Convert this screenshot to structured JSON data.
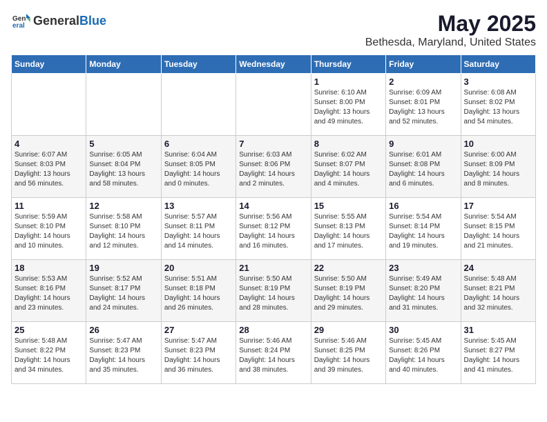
{
  "header": {
    "logo_general": "General",
    "logo_blue": "Blue",
    "title": "May 2025",
    "subtitle": "Bethesda, Maryland, United States"
  },
  "days_of_week": [
    "Sunday",
    "Monday",
    "Tuesday",
    "Wednesday",
    "Thursday",
    "Friday",
    "Saturday"
  ],
  "weeks": [
    [
      {
        "day": "",
        "info": ""
      },
      {
        "day": "",
        "info": ""
      },
      {
        "day": "",
        "info": ""
      },
      {
        "day": "",
        "info": ""
      },
      {
        "day": "1",
        "info": "Sunrise: 6:10 AM\nSunset: 8:00 PM\nDaylight: 13 hours\nand 49 minutes."
      },
      {
        "day": "2",
        "info": "Sunrise: 6:09 AM\nSunset: 8:01 PM\nDaylight: 13 hours\nand 52 minutes."
      },
      {
        "day": "3",
        "info": "Sunrise: 6:08 AM\nSunset: 8:02 PM\nDaylight: 13 hours\nand 54 minutes."
      }
    ],
    [
      {
        "day": "4",
        "info": "Sunrise: 6:07 AM\nSunset: 8:03 PM\nDaylight: 13 hours\nand 56 minutes."
      },
      {
        "day": "5",
        "info": "Sunrise: 6:05 AM\nSunset: 8:04 PM\nDaylight: 13 hours\nand 58 minutes."
      },
      {
        "day": "6",
        "info": "Sunrise: 6:04 AM\nSunset: 8:05 PM\nDaylight: 14 hours\nand 0 minutes."
      },
      {
        "day": "7",
        "info": "Sunrise: 6:03 AM\nSunset: 8:06 PM\nDaylight: 14 hours\nand 2 minutes."
      },
      {
        "day": "8",
        "info": "Sunrise: 6:02 AM\nSunset: 8:07 PM\nDaylight: 14 hours\nand 4 minutes."
      },
      {
        "day": "9",
        "info": "Sunrise: 6:01 AM\nSunset: 8:08 PM\nDaylight: 14 hours\nand 6 minutes."
      },
      {
        "day": "10",
        "info": "Sunrise: 6:00 AM\nSunset: 8:09 PM\nDaylight: 14 hours\nand 8 minutes."
      }
    ],
    [
      {
        "day": "11",
        "info": "Sunrise: 5:59 AM\nSunset: 8:10 PM\nDaylight: 14 hours\nand 10 minutes."
      },
      {
        "day": "12",
        "info": "Sunrise: 5:58 AM\nSunset: 8:10 PM\nDaylight: 14 hours\nand 12 minutes."
      },
      {
        "day": "13",
        "info": "Sunrise: 5:57 AM\nSunset: 8:11 PM\nDaylight: 14 hours\nand 14 minutes."
      },
      {
        "day": "14",
        "info": "Sunrise: 5:56 AM\nSunset: 8:12 PM\nDaylight: 14 hours\nand 16 minutes."
      },
      {
        "day": "15",
        "info": "Sunrise: 5:55 AM\nSunset: 8:13 PM\nDaylight: 14 hours\nand 17 minutes."
      },
      {
        "day": "16",
        "info": "Sunrise: 5:54 AM\nSunset: 8:14 PM\nDaylight: 14 hours\nand 19 minutes."
      },
      {
        "day": "17",
        "info": "Sunrise: 5:54 AM\nSunset: 8:15 PM\nDaylight: 14 hours\nand 21 minutes."
      }
    ],
    [
      {
        "day": "18",
        "info": "Sunrise: 5:53 AM\nSunset: 8:16 PM\nDaylight: 14 hours\nand 23 minutes."
      },
      {
        "day": "19",
        "info": "Sunrise: 5:52 AM\nSunset: 8:17 PM\nDaylight: 14 hours\nand 24 minutes."
      },
      {
        "day": "20",
        "info": "Sunrise: 5:51 AM\nSunset: 8:18 PM\nDaylight: 14 hours\nand 26 minutes."
      },
      {
        "day": "21",
        "info": "Sunrise: 5:50 AM\nSunset: 8:19 PM\nDaylight: 14 hours\nand 28 minutes."
      },
      {
        "day": "22",
        "info": "Sunrise: 5:50 AM\nSunset: 8:19 PM\nDaylight: 14 hours\nand 29 minutes."
      },
      {
        "day": "23",
        "info": "Sunrise: 5:49 AM\nSunset: 8:20 PM\nDaylight: 14 hours\nand 31 minutes."
      },
      {
        "day": "24",
        "info": "Sunrise: 5:48 AM\nSunset: 8:21 PM\nDaylight: 14 hours\nand 32 minutes."
      }
    ],
    [
      {
        "day": "25",
        "info": "Sunrise: 5:48 AM\nSunset: 8:22 PM\nDaylight: 14 hours\nand 34 minutes."
      },
      {
        "day": "26",
        "info": "Sunrise: 5:47 AM\nSunset: 8:23 PM\nDaylight: 14 hours\nand 35 minutes."
      },
      {
        "day": "27",
        "info": "Sunrise: 5:47 AM\nSunset: 8:23 PM\nDaylight: 14 hours\nand 36 minutes."
      },
      {
        "day": "28",
        "info": "Sunrise: 5:46 AM\nSunset: 8:24 PM\nDaylight: 14 hours\nand 38 minutes."
      },
      {
        "day": "29",
        "info": "Sunrise: 5:46 AM\nSunset: 8:25 PM\nDaylight: 14 hours\nand 39 minutes."
      },
      {
        "day": "30",
        "info": "Sunrise: 5:45 AM\nSunset: 8:26 PM\nDaylight: 14 hours\nand 40 minutes."
      },
      {
        "day": "31",
        "info": "Sunrise: 5:45 AM\nSunset: 8:27 PM\nDaylight: 14 hours\nand 41 minutes."
      }
    ]
  ]
}
